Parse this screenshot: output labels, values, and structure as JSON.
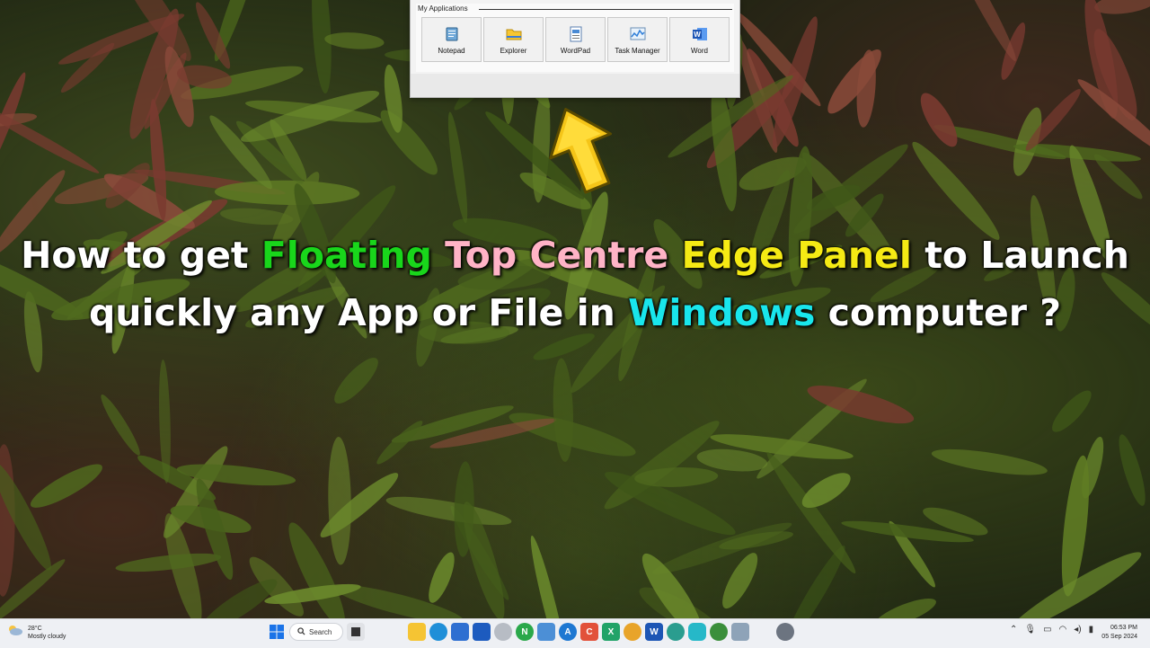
{
  "panel": {
    "group_label": "My Applications",
    "apps": [
      {
        "label": "Notepad",
        "icon": "notepad-icon"
      },
      {
        "label": "Explorer",
        "icon": "folder-icon"
      },
      {
        "label": "WordPad",
        "icon": "wordpad-icon"
      },
      {
        "label": "Task Manager",
        "icon": "task-manager-icon"
      },
      {
        "label": "Word",
        "icon": "word-icon"
      }
    ]
  },
  "headline": {
    "p1": "How to get ",
    "p2": "Floating",
    "p3": " ",
    "p4": "Top Centre",
    "p5": " ",
    "p6": "Edge Panel",
    "p7": " to Launch",
    "p8": "quickly any App or File in ",
    "p9": "Windows",
    "p10": " computer ?"
  },
  "taskbar": {
    "temperature": "28°C",
    "weather": "Mostly cloudy",
    "search_label": "Search",
    "time": "06:53 PM",
    "date": "05 Sep 2024"
  },
  "colors": {
    "green": "#19d61b",
    "pink": "#ffb3c6",
    "yellow": "#f5ea14",
    "cyan": "#19e6ec",
    "arrow": "#f5c518"
  }
}
